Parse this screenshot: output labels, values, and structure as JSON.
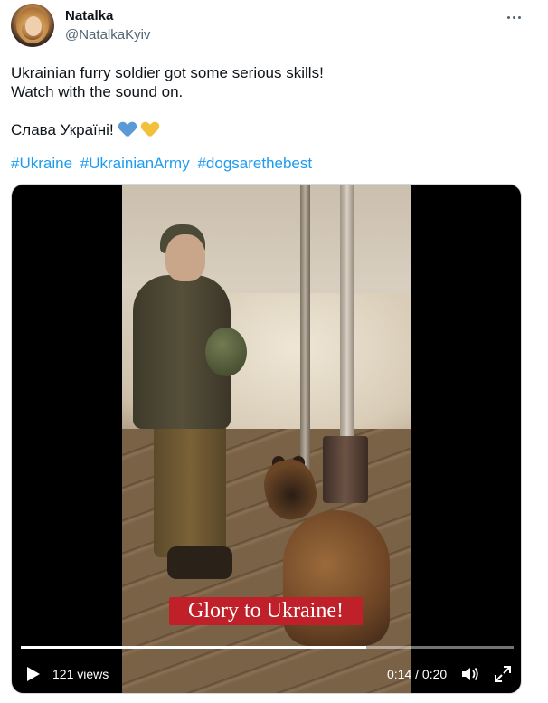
{
  "tweet": {
    "author_name": "Natalka",
    "author_handle": "@NatalkaKyiv",
    "text_line1": "Ukrainian furry soldier got some serious skills!",
    "text_line2": "Watch with the sound on.",
    "text_line3": "Слава Україні!",
    "hearts": [
      "blue-heart-icon",
      "yellow-heart-icon"
    ],
    "hashtags": [
      "#Ukraine",
      "#UkrainianArmy",
      "#dogsarethebest"
    ]
  },
  "video": {
    "caption": "Glory to Ukraine!",
    "views": "121 views",
    "time": "0:14 / 0:20",
    "progress": 0.7
  },
  "colors": {
    "link": "#1d9bf0",
    "caption_bg": "#c0202a",
    "heart_blue": "#5b9bd5",
    "heart_yellow": "#f2c13b"
  },
  "icons": [
    "more-icon",
    "play-icon",
    "volume-icon",
    "fullscreen-icon"
  ]
}
